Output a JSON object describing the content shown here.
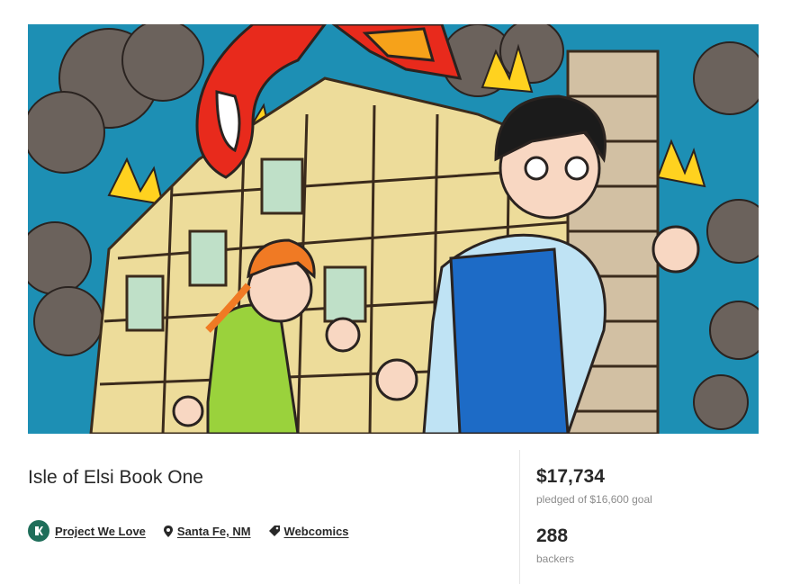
{
  "project": {
    "title": "Isle of Elsi Book One",
    "badge_label": "Project We Love",
    "location": "Santa Fe, NM",
    "category": "Webcomics"
  },
  "stats": {
    "pledged_amount": "$17,734",
    "pledged_caption": "pledged of $16,600 goal",
    "backers_count": "288",
    "backers_caption": "backers"
  },
  "icons": {
    "badge": "kickstarter-badge-icon",
    "location": "map-pin-icon",
    "category": "tag-icon"
  },
  "colors": {
    "badge_bg": "#1f6e5a",
    "text": "#282828",
    "muted": "#8c8c8c",
    "hero_sky": "#1d8fb4"
  }
}
